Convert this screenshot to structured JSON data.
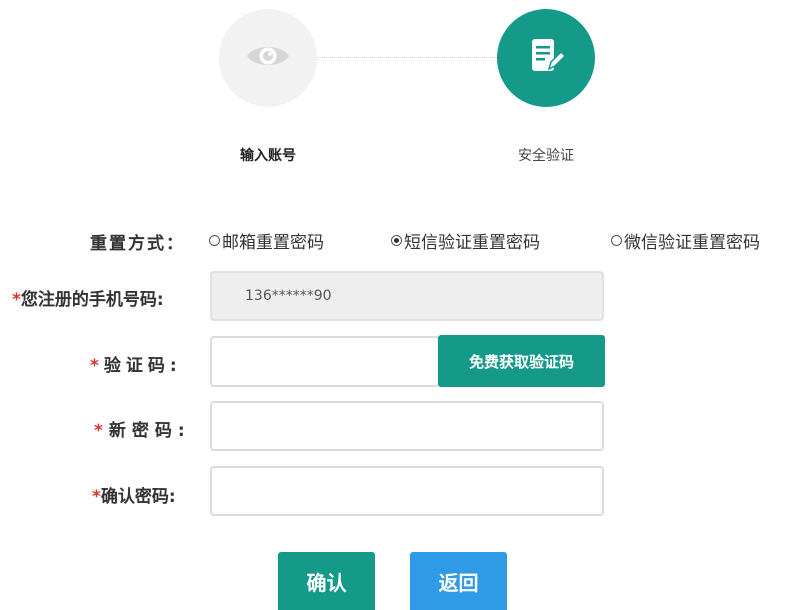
{
  "steps": [
    {
      "label": "输入账号",
      "icon": "eye-icon",
      "active": false
    },
    {
      "label": "安全验证",
      "icon": "document-edit-icon",
      "active": true
    }
  ],
  "colors": {
    "primary": "#159a8a",
    "secondary": "#2f9be6",
    "required": "#d9342b",
    "inactive_step": "#f2f2f2"
  },
  "form": {
    "reset_mode_label": "重置方式：",
    "reset_options": [
      {
        "label": "邮箱重置密码",
        "checked": false
      },
      {
        "label": "短信验证重置密码",
        "checked": true
      },
      {
        "label": "微信验证重置密码",
        "checked": false
      }
    ],
    "phone": {
      "label": "您注册的手机号码:",
      "value": "136******90"
    },
    "code": {
      "label": "验证码:",
      "value": ""
    },
    "new_password": {
      "label": "新密码:",
      "value": ""
    },
    "confirm_password": {
      "label": "确认密码:",
      "value": ""
    },
    "required_mark": "*",
    "get_code_button": "免费获取验证码"
  },
  "actions": {
    "confirm": "确认",
    "back": "返回"
  }
}
